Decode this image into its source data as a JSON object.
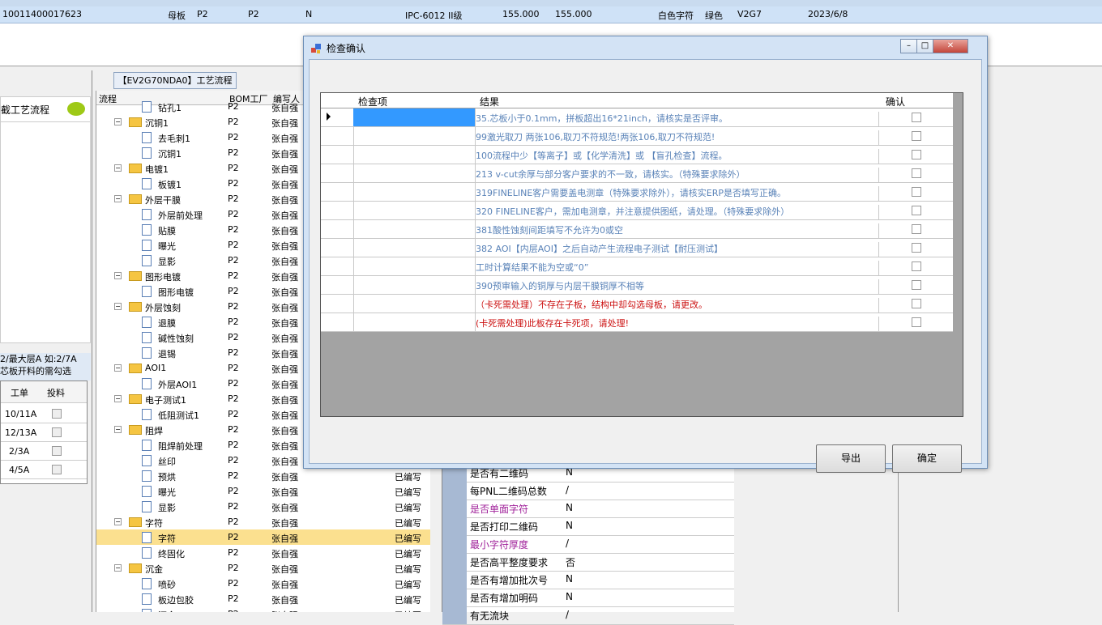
{
  "top_row": {
    "id": "10011400017623",
    "type": "母板",
    "p1": "P2",
    "p2": "P2",
    "flag": "N",
    "material": "IPC-6012 II级",
    "v1": "155.000",
    "v2": "155.000",
    "text_color": "白色字符",
    "mask_color": "绿色",
    "code": "V2G7",
    "date": "2023/6/8"
  },
  "left_panel": {
    "title": "截工艺流程",
    "note_line1": "2/最大层A 如:2/7A",
    "note_line2": "芯板开料的需勾选",
    "grid_headers": [
      "工单",
      "投料"
    ],
    "grid_rows": [
      "10/11A",
      "12/13A",
      "2/3A",
      "4/5A"
    ]
  },
  "tree": {
    "tab_label": "【EV2G70NDA0】工艺流程",
    "headers": {
      "name": "流程",
      "plant": "BOM工厂",
      "author": "编写人"
    },
    "items": [
      {
        "name": "钻孔1",
        "level": 2,
        "kind": "doc",
        "plant": "P2",
        "author": "张自强",
        "state": ""
      },
      {
        "name": "沉铜1",
        "level": 1,
        "kind": "folder",
        "plant": "P2",
        "author": "张自强",
        "state": ""
      },
      {
        "name": "去毛刺1",
        "level": 2,
        "kind": "doc",
        "plant": "P2",
        "author": "张自强",
        "state": ""
      },
      {
        "name": "沉铜1",
        "level": 2,
        "kind": "doc",
        "plant": "P2",
        "author": "张自强",
        "state": ""
      },
      {
        "name": "电镀1",
        "level": 1,
        "kind": "folder",
        "plant": "P2",
        "author": "张自强",
        "state": ""
      },
      {
        "name": "板镀1",
        "level": 2,
        "kind": "doc",
        "plant": "P2",
        "author": "张自强",
        "state": ""
      },
      {
        "name": "外层干膜",
        "level": 1,
        "kind": "folder",
        "plant": "P2",
        "author": "张自强",
        "state": ""
      },
      {
        "name": "外层前处理",
        "level": 2,
        "kind": "doc",
        "plant": "P2",
        "author": "张自强",
        "state": ""
      },
      {
        "name": "贴膜",
        "level": 2,
        "kind": "doc",
        "plant": "P2",
        "author": "张自强",
        "state": ""
      },
      {
        "name": "曝光",
        "level": 2,
        "kind": "doc",
        "plant": "P2",
        "author": "张自强",
        "state": ""
      },
      {
        "name": "显影",
        "level": 2,
        "kind": "doc",
        "plant": "P2",
        "author": "张自强",
        "state": ""
      },
      {
        "name": "图形电镀",
        "level": 1,
        "kind": "folder",
        "plant": "P2",
        "author": "张自强",
        "state": ""
      },
      {
        "name": "图形电镀",
        "level": 2,
        "kind": "doc",
        "plant": "P2",
        "author": "张自强",
        "state": ""
      },
      {
        "name": "外层蚀刻",
        "level": 1,
        "kind": "folder",
        "plant": "P2",
        "author": "张自强",
        "state": ""
      },
      {
        "name": "退膜",
        "level": 2,
        "kind": "doc",
        "plant": "P2",
        "author": "张自强",
        "state": ""
      },
      {
        "name": "碱性蚀刻",
        "level": 2,
        "kind": "doc",
        "plant": "P2",
        "author": "张自强",
        "state": ""
      },
      {
        "name": "退锡",
        "level": 2,
        "kind": "doc",
        "plant": "P2",
        "author": "张自强",
        "state": ""
      },
      {
        "name": "AOI1",
        "level": 1,
        "kind": "folder",
        "plant": "P2",
        "author": "张自强",
        "state": ""
      },
      {
        "name": "外层AOI1",
        "level": 2,
        "kind": "doc",
        "plant": "P2",
        "author": "张自强",
        "state": ""
      },
      {
        "name": "电子测试1",
        "level": 1,
        "kind": "folder",
        "plant": "P2",
        "author": "张自强",
        "state": ""
      },
      {
        "name": "低阻测试1",
        "level": 2,
        "kind": "doc",
        "plant": "P2",
        "author": "张自强",
        "state": ""
      },
      {
        "name": "阻焊",
        "level": 1,
        "kind": "folder",
        "plant": "P2",
        "author": "张自强",
        "state": ""
      },
      {
        "name": "阻焊前处理",
        "level": 2,
        "kind": "doc",
        "plant": "P2",
        "author": "张自强",
        "state": ""
      },
      {
        "name": "丝印",
        "level": 2,
        "kind": "doc",
        "plant": "P2",
        "author": "张自强",
        "state": ""
      },
      {
        "name": "预烘",
        "level": 2,
        "kind": "doc",
        "plant": "P2",
        "author": "张自强",
        "state": "已编写"
      },
      {
        "name": "曝光",
        "level": 2,
        "kind": "doc",
        "plant": "P2",
        "author": "张自强",
        "state": "已编写"
      },
      {
        "name": "显影",
        "level": 2,
        "kind": "doc",
        "plant": "P2",
        "author": "张自强",
        "state": "已编写"
      },
      {
        "name": "字符",
        "level": 1,
        "kind": "folder",
        "plant": "P2",
        "author": "张自强",
        "state": "已编写"
      },
      {
        "name": "字符",
        "level": 2,
        "kind": "doc",
        "plant": "P2",
        "author": "张自强",
        "state": "已编写",
        "selected": true
      },
      {
        "name": "终固化",
        "level": 2,
        "kind": "doc",
        "plant": "P2",
        "author": "张自强",
        "state": "已编写"
      },
      {
        "name": "沉金",
        "level": 1,
        "kind": "folder",
        "plant": "P2",
        "author": "张自强",
        "state": "已编写"
      },
      {
        "name": "喷砂",
        "level": 2,
        "kind": "doc",
        "plant": "P2",
        "author": "张自强",
        "state": "已编写"
      },
      {
        "name": "板边包胶",
        "level": 2,
        "kind": "doc",
        "plant": "P2",
        "author": "张自强",
        "state": "已编写"
      },
      {
        "name": "沉金",
        "level": 2,
        "kind": "doc",
        "plant": "P2",
        "author": "张自强",
        "state": "已编写"
      }
    ]
  },
  "prop_grid": [
    {
      "key": "是否有二维码",
      "value": "N",
      "color": "#000000"
    },
    {
      "key": "每PNL二维码总数",
      "value": "/",
      "color": "#000000"
    },
    {
      "key": "是否单面字符",
      "value": "N",
      "color": "#a0219a"
    },
    {
      "key": "是否打印二维码",
      "value": "N",
      "color": "#000000"
    },
    {
      "key": "最小字符厚度",
      "value": "/",
      "color": "#a0219a"
    },
    {
      "key": "是否高平整度要求",
      "value": "否",
      "color": "#000000"
    },
    {
      "key": "是否有增加批次号",
      "value": "N",
      "color": "#000000"
    },
    {
      "key": "是否有增加明码",
      "value": "N",
      "color": "#000000"
    },
    {
      "key": "有无流块",
      "value": "/",
      "color": "#000000"
    }
  ],
  "dialog": {
    "title": "检查确认",
    "columns": {
      "item": "检查项",
      "result": "结果",
      "confirm": "确认"
    },
    "rows": [
      {
        "result": "35.芯板小于0.1mm，拼板超出16*21inch，请核实是否评审。",
        "color": "blue"
      },
      {
        "result": "99激光取刀 两张106,取刀不符规范!两张106,取刀不符规范!",
        "color": "blue"
      },
      {
        "result": "100流程中少【等离子】或【化学清洗】或 【盲孔检查】流程。",
        "color": "blue"
      },
      {
        "result": "213 v-cut余厚与部分客户要求的不一致，请核实。（特殊要求除外）",
        "color": "blue"
      },
      {
        "result": "319FINELINE客户需要盖电测章（特殊要求除外），请核实ERP是否填写正确。",
        "color": "blue"
      },
      {
        "result": "320 FINELINE客户，需加电测章，并注意提供图纸，请处理。（特殊要求除外）",
        "color": "blue"
      },
      {
        "result": "381酸性蚀刻间距填写不允许为0或空",
        "color": "blue"
      },
      {
        "result": "382 AOI【内层AOI】之后自动产生流程电子测试【耐压测试】",
        "color": "blue"
      },
      {
        "result": "工时计算结果不能为空或“0”",
        "color": "blue"
      },
      {
        "result": "390预审输入的铜厚与内层干膜铜厚不相等",
        "color": "blue"
      },
      {
        "result": "（卡死需处理）不存在子板，结构中却勾选母板，请更改。",
        "color": "red"
      },
      {
        "result": "(卡死需处理)此板存在卡死项，请处理!",
        "color": "red"
      }
    ],
    "export_label": "导出",
    "ok_label": "确定",
    "close_label": "✕",
    "min_label": "–",
    "max_label": "□"
  }
}
